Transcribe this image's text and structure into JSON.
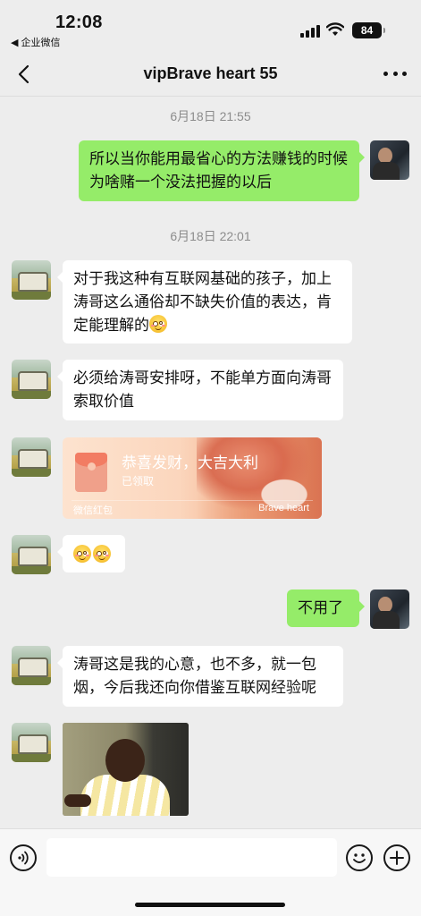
{
  "status_bar": {
    "time": "12:08",
    "back_app": "◀ 企业微信",
    "battery": "84"
  },
  "nav": {
    "title": "vipBrave heart 55"
  },
  "chat": {
    "timestamp_1": "6月18日 21:55",
    "timestamp_2": "6月18日 22:01",
    "msg_self_1": "所以当你能用最省心的方法赚钱的时候 为啥赌一个没法把握的以后",
    "msg_other_1": "对于我这种有互联网基础的孩子，加上涛哥这么通俗却不缺失价值的表达，肯定能理解的",
    "msg_other_2": "必须给涛哥安排呀，不能单方面向涛哥索取价值",
    "red_packet": {
      "title": "恭喜发财，大吉大利",
      "status": "已领取",
      "label": "微信红包",
      "sender": "Brave heart"
    },
    "msg_self_2": "不用了",
    "msg_other_4": "涛哥这是我的心意，也不多，就一包烟，今后我还向你借鉴互联网经验呢"
  },
  "colors": {
    "self_bubble": "#95ec69",
    "other_bubble": "#ffffff",
    "background": "#ededed"
  },
  "icons": [
    "back-chevron-icon",
    "more-dots-icon",
    "voice-icon",
    "emoji-icon",
    "plus-icon",
    "signal-icon",
    "wifi-icon"
  ]
}
